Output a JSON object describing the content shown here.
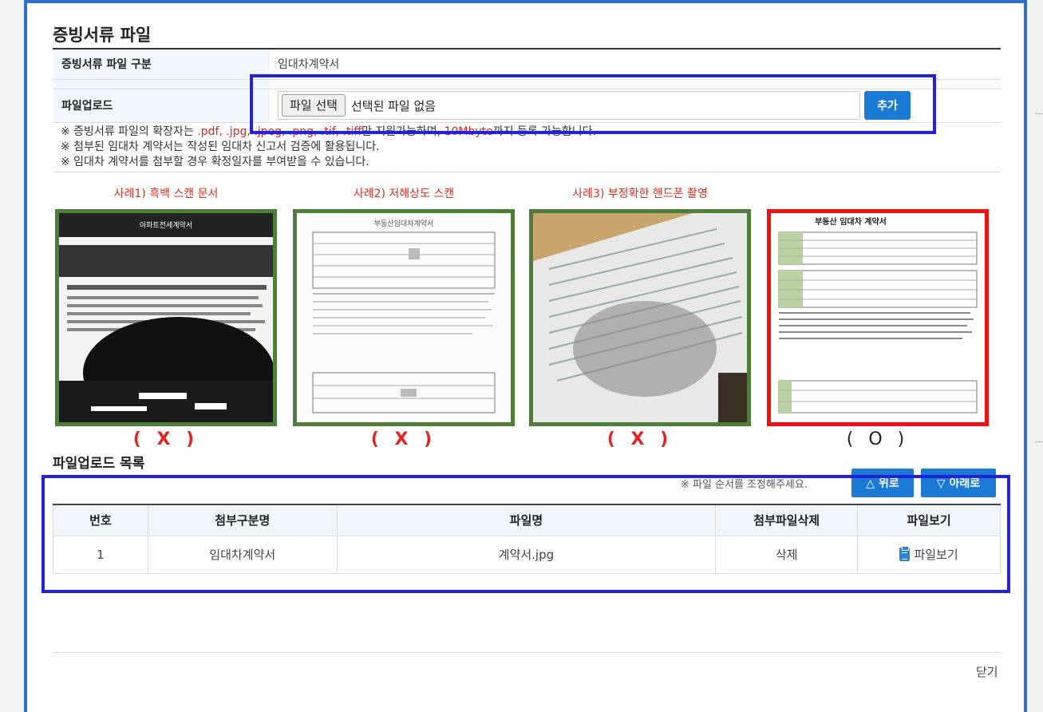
{
  "modal": {
    "title": "증빙서류 파일",
    "category_label": "증빙서류 파일 구분",
    "category_value": "임대차계약서",
    "upload_label": "파일업로드",
    "file_button_label": "파일 선택",
    "file_status": "선택된 파일 없음",
    "add_button_label": "추가",
    "notes": [
      {
        "prefix": "※ 증빙서류 파일의 확장자는 ",
        "ext": ".pdf, .jpg, .jpeg, .png, .tif, .tiff",
        "mid": "만 지원가능하며, ",
        "size": "10Mbyte",
        "suffix": "까지 등록 가능합니다."
      },
      {
        "text": "※ 첨부된 임대차 계약서는 작성된 임대차 신고서 검증에 활용됩니다."
      },
      {
        "text": "※ 임대차 계약서를 첨부할 경우 확정일자를 부여받을 수 있습니다."
      }
    ]
  },
  "samples": [
    {
      "caption": "사례1) 흑백 스캔 문서",
      "mark": "( X )"
    },
    {
      "caption": "사례2) 저해상도 스캔",
      "mark": "( X )"
    },
    {
      "caption": "사례3) 부정확한 핸드폰 촬영",
      "mark": "( X )"
    },
    {
      "caption": "",
      "mark": "( O )",
      "doc_title": "부동산 임대차 계약서"
    }
  ],
  "upload_list": {
    "title": "파일업로드 목록",
    "order_note": "※ 파일 순서를 조정해주세요.",
    "up_button": "△ 위로",
    "down_button": "▽ 아래로",
    "columns": [
      "번호",
      "첨부구분명",
      "파일명",
      "첨부파일삭제",
      "파일보기"
    ],
    "rows": [
      {
        "no": "1",
        "category": "임대차계약서",
        "filename": "계약서.jpg",
        "delete": "삭제",
        "view": "파일보기"
      }
    ]
  },
  "footer": {
    "close_label": "닫기"
  },
  "colors": {
    "accent": "#1a7ad4",
    "highlight": "#2222dd",
    "bad_border": "#4f7e3a",
    "good_border": "#ee1111",
    "warn_text": "#e0261f"
  }
}
